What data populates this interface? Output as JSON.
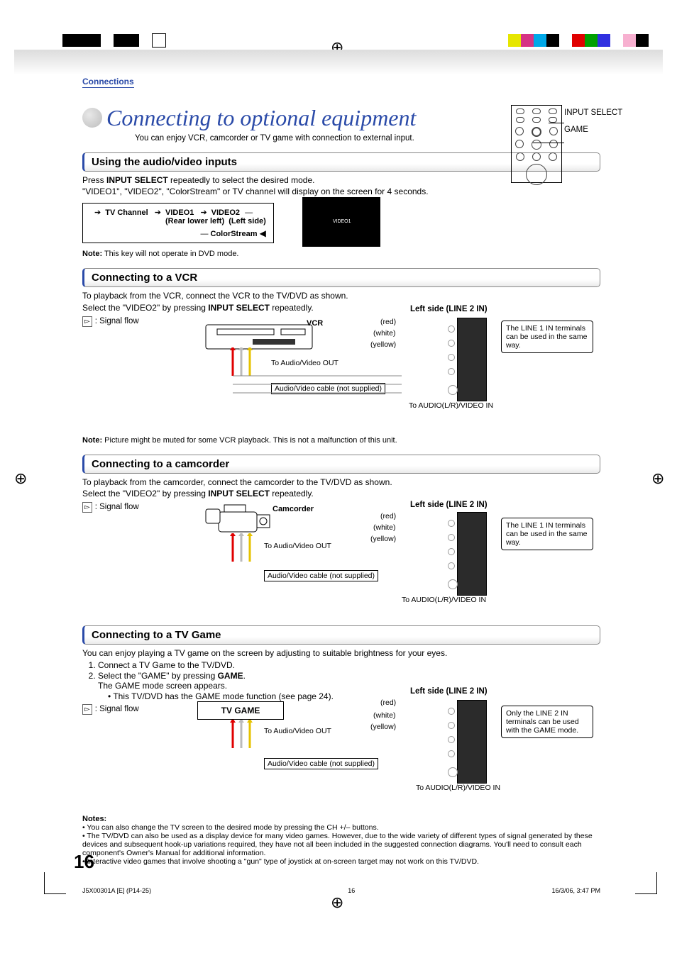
{
  "header": {
    "section_label": "Connections"
  },
  "title": {
    "main": "Connecting to optional equipment",
    "sub": "You can enjoy VCR, camcorder or TV game with connection to external input."
  },
  "remote": {
    "label_input_select": "INPUT SELECT",
    "label_game": "GAME"
  },
  "using_av": {
    "heading": "Using the audio/video inputs",
    "press_prefix": "Press ",
    "press_bold": "INPUT SELECT",
    "press_suffix": " repeatedly to select the desired mode.",
    "line2": "\"VIDEO1\", \"VIDEO2\", \"ColorStream\" or TV channel will display on the screen for 4 seconds.",
    "flow": {
      "tv": "TV Channel",
      "v1": "VIDEO1",
      "v1_sub": "(Rear lower left)",
      "v2": "VIDEO2",
      "v2_sub": "(Left side)",
      "cs": "ColorStream"
    },
    "screen_text": "VIDEO1",
    "note_bold": "Note:",
    "note_text": " This key will not operate in DVD mode."
  },
  "vcr": {
    "heading": "Connecting to a VCR",
    "line1": "To playback from the VCR, connect the VCR to the TV/DVD as shown.",
    "line2_pre": "Select the \"VIDEO2\" by pressing ",
    "line2_bold": "INPUT SELECT",
    "line2_suf": " repeatedly.",
    "signal_flow": ": Signal flow",
    "device_label": "VCR",
    "to_av_out": "To Audio/Video OUT",
    "cable": "Audio/Video cable  (not supplied)",
    "side_title": "Left side (LINE 2 IN)",
    "colors": {
      "red": "(red)",
      "white": "(white)",
      "yellow": "(yellow)"
    },
    "to_av_in": "To AUDIO(L/R)/VIDEO IN",
    "hint": "The LINE 1 IN terminals can be used in the same way.",
    "note_bold": "Note:",
    "note_text": " Picture might be muted for some VCR playback. This is not a malfunction of this unit."
  },
  "cam": {
    "heading": "Connecting to a camcorder",
    "line1": "To playback from the camcorder, connect the camcorder to the TV/DVD as shown.",
    "line2_pre": "Select the \"VIDEO2\" by pressing ",
    "line2_bold": "INPUT SELECT",
    "line2_suf": " repeatedly.",
    "signal_flow": ": Signal flow",
    "device_label": "Camcorder",
    "to_av_out": "To Audio/Video OUT",
    "cable": "Audio/Video cable (not supplied)",
    "side_title": "Left side (LINE 2 IN)",
    "to_av_in": "To AUDIO(L/R)/VIDEO IN",
    "hint": "The LINE 1 IN terminals can be used in the same way."
  },
  "game": {
    "heading": "Connecting to a TV Game",
    "intro": "You can enjoy playing a TV game on the screen by adjusting to suitable brightness for your eyes.",
    "step1": "Connect a TV Game to the TV/DVD.",
    "step2_pre": "Select the \"GAME\" by pressing ",
    "step2_bold": "GAME",
    "step2_suf": ".",
    "step2b": "The GAME mode screen appears.",
    "bullet1": "This TV/DVD has the GAME mode function (see page 24).",
    "signal_flow": ": Signal flow",
    "device_label": "TV GAME",
    "to_av_out": "To Audio/Video OUT",
    "cable": "Audio/Video cable (not supplied)",
    "side_title": "Left side (LINE 2 IN)",
    "to_av_in": "To AUDIO(L/R)/VIDEO IN",
    "hint": "Only the LINE 2 IN terminals can be used with the GAME mode."
  },
  "notes": {
    "heading": "Notes:",
    "n1": "You can also change the TV screen to the desired mode by pressing the CH +/– buttons.",
    "n2": "The TV/DVD can also be used as a display device for many video games. However, due to the wide variety of different types of signal generated by these devices and subsequent hook-up variations required, they have not all been included in the suggested connection diagrams. You'll need to consult each component's Owner's Manual for additional information.",
    "n3": "Interactive video games that involve shooting a \"gun\" type of joystick at on-screen target may not work on this TV/DVD."
  },
  "page_number": "16",
  "footer": {
    "doc": "J5X00301A [E] (P14-25)",
    "page": "16",
    "date": "16/3/06, 3:47 PM"
  }
}
